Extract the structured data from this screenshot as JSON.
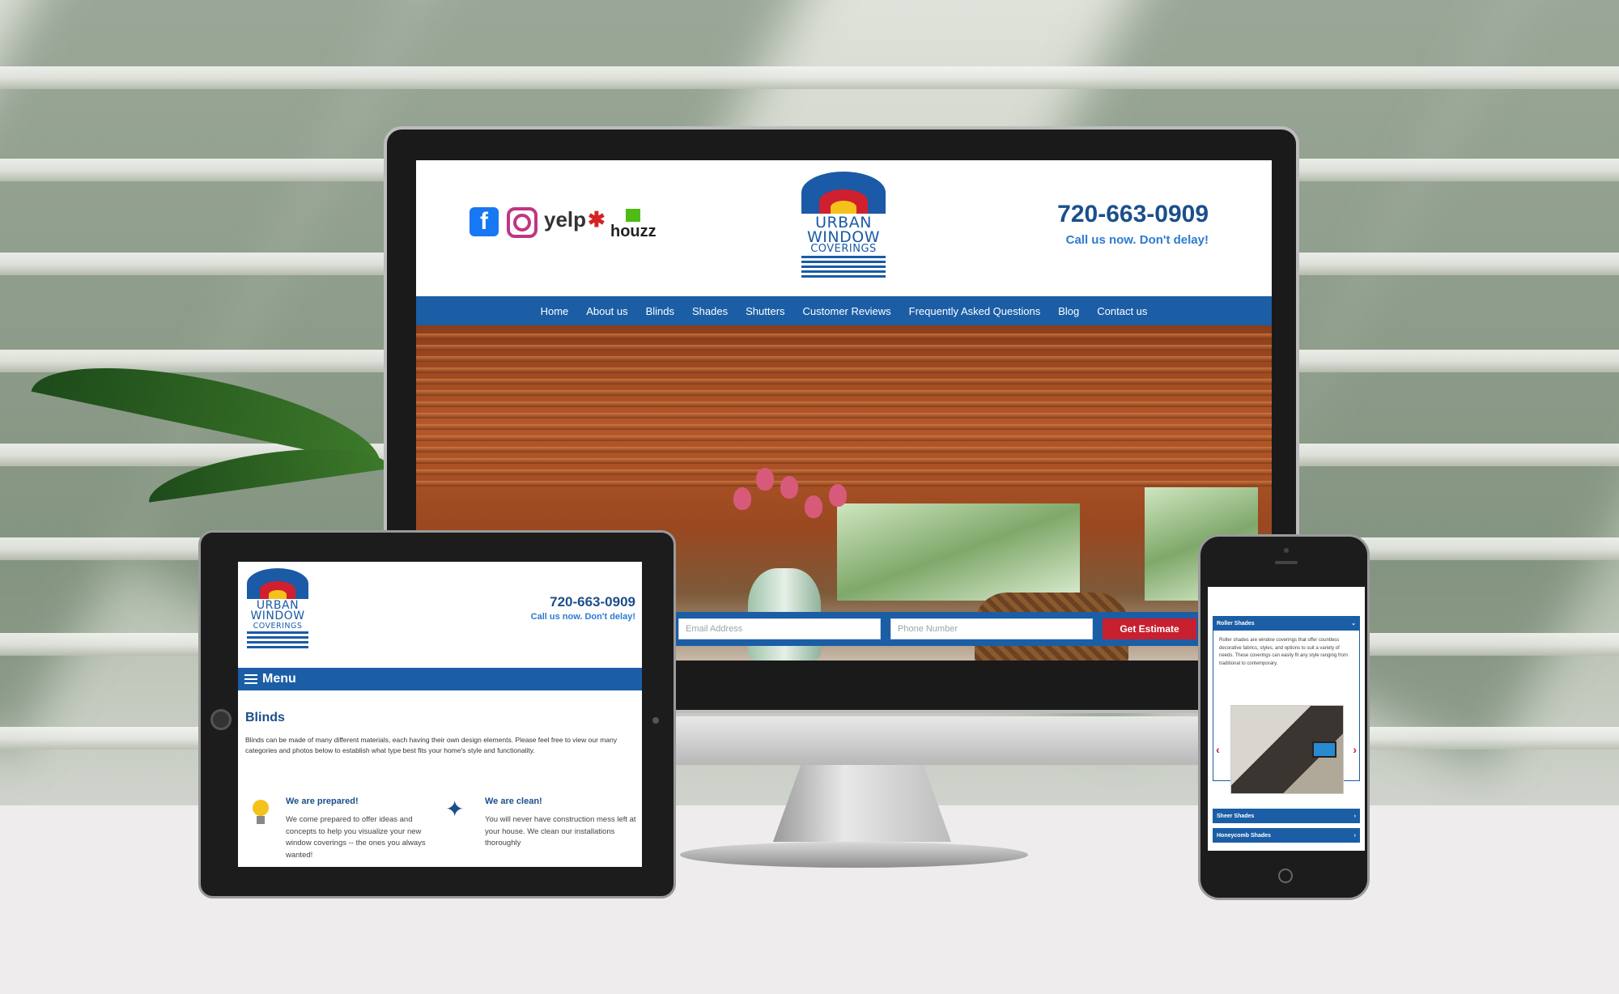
{
  "desktop": {
    "social": {
      "facebook": "f",
      "yelp": "yelp",
      "houzz": "houzz"
    },
    "logo": {
      "line1": "URBAN",
      "line2": "WINDOW",
      "line3": "COVERINGS"
    },
    "phone": "720-663-0909",
    "cta": "Call us now. Don't delay!",
    "nav": [
      "Home",
      "About us",
      "Blinds",
      "Shades",
      "Shutters",
      "Customer Reviews",
      "Frequently Asked Questions",
      "Blog",
      "Contact us"
    ],
    "form": {
      "email_placeholder": "Email Address",
      "phone_placeholder": "Phone Number",
      "submit": "Get Estimate"
    }
  },
  "tablet": {
    "logo": {
      "line1": "URBAN",
      "line2": "WINDOW",
      "line3": "COVERINGS"
    },
    "phone": "720-663-0909",
    "cta": "Call us now. Don't delay!",
    "menu": "Menu",
    "title": "Blinds",
    "intro": "Blinds can be made of many different materials, each having their own design elements. Please feel free to view our many categories and photos below to establish what type best fits your home's style and functionality.",
    "features": [
      {
        "title": "We are prepared!",
        "text": "We come prepared to offer ideas and concepts to help you visualize your new window coverings -- the ones you always wanted!"
      },
      {
        "title": "We are clean!",
        "text": "You will never have construction mess left at your house. We clean our installations thoroughly"
      }
    ]
  },
  "phone": {
    "accordion": [
      {
        "label": "Roller Shades",
        "icon": "chevron-down-icon"
      },
      {
        "label": "Sheer Shades",
        "icon": "chevron-right-icon"
      },
      {
        "label": "Honeycomb Shades",
        "icon": "chevron-right-icon"
      }
    ],
    "roller_text": "Roller shades are window coverings that offer countless decorative fabrics, styles, and options to suit a variety of needs. These coverings can easily fit any style ranging from traditional to contemporary."
  },
  "colors": {
    "brand_blue": "#1b5ea6",
    "brand_red": "#c8202f",
    "brand_yellow": "#f4c21a"
  }
}
